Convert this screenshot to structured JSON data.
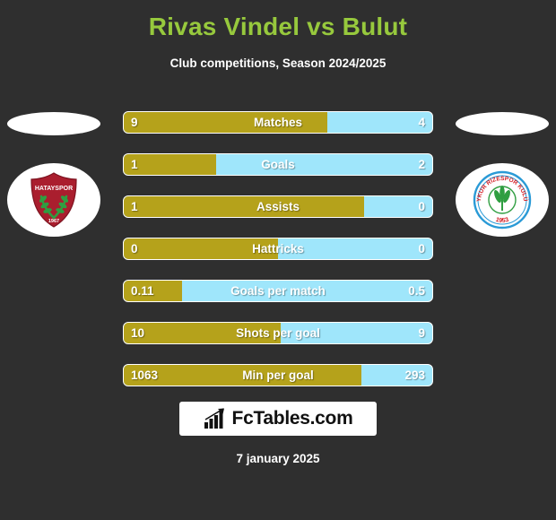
{
  "header": {
    "title": "Rivas Vindel vs Bulut",
    "subtitle": "Club competitions, Season 2024/2025",
    "title_color": "#97c93d"
  },
  "teams": {
    "home": {
      "name": "Hatayspor",
      "badge_icon": "hatayspor-crest-icon",
      "crest_text": "HATAYSPOR",
      "crest_year": "1967",
      "shield_color": "#aa1e2e",
      "wreath_color": "#2f9e41"
    },
    "away": {
      "name": "Caykur Rizespor",
      "badge_icon": "caykur-rizespor-crest-icon",
      "crest_text": "ÇAYKUR RİZESPOR KULÜBÜ",
      "crest_year": "1953",
      "ring_color": "#2a9ad6",
      "text_color": "#d42027",
      "leaf_color": "#2f9e41"
    }
  },
  "colors": {
    "background": "#2f2f2f",
    "home_bar": "#b5a21b",
    "away_bar": "#9fe6fb",
    "bar_border": "#ffffff"
  },
  "chart_data": {
    "type": "bar",
    "title": "Rivas Vindel vs Bulut",
    "subtitle": "Club competitions, Season 2024/2025",
    "orientation": "horizontal-diverging",
    "series": [
      {
        "name": "Rivas Vindel",
        "color": "#b5a21b"
      },
      {
        "name": "Bulut",
        "color": "#9fe6fb"
      }
    ],
    "categories": [
      "Matches",
      "Goals",
      "Assists",
      "Hattricks",
      "Goals per match",
      "Shots per goal",
      "Min per goal"
    ],
    "rows": [
      {
        "label": "Matches",
        "home": "9",
        "away": "4",
        "home_pct": 66
      },
      {
        "label": "Goals",
        "home": "1",
        "away": "2",
        "home_pct": 30
      },
      {
        "label": "Assists",
        "home": "1",
        "away": "0",
        "home_pct": 78
      },
      {
        "label": "Hattricks",
        "home": "0",
        "away": "0",
        "home_pct": 50
      },
      {
        "label": "Goals per match",
        "home": "0.11",
        "away": "0.5",
        "home_pct": 19
      },
      {
        "label": "Shots per goal",
        "home": "10",
        "away": "9",
        "home_pct": 51
      },
      {
        "label": "Min per goal",
        "home": "1063",
        "away": "293",
        "home_pct": 77
      }
    ]
  },
  "footer": {
    "brand": "FcTables.com",
    "brand_icon": "bar-chart-arrow-icon",
    "date": "7 january 2025"
  }
}
